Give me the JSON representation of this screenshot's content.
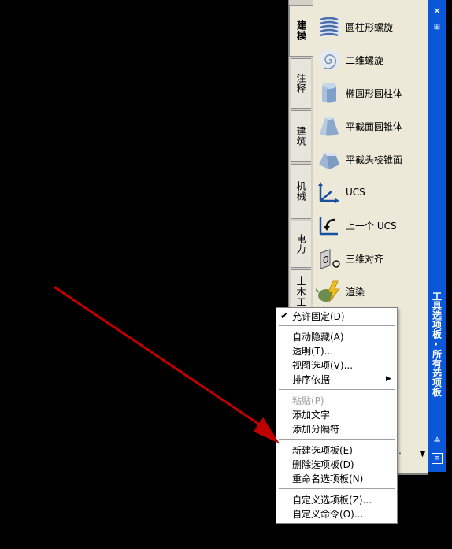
{
  "palette": {
    "tabs": [
      "建模",
      "注释",
      "建筑",
      "机械",
      "电力",
      "土木工程"
    ],
    "tools": [
      {
        "label": "圆柱形螺旋",
        "icon": "helix-icon"
      },
      {
        "label": "二维螺旋",
        "icon": "spiral-icon"
      },
      {
        "label": "椭圆形圆柱体",
        "icon": "elliptical-cylinder-icon"
      },
      {
        "label": "平截面圆锥体",
        "icon": "frustum-cone-icon"
      },
      {
        "label": "平截头棱锥面",
        "icon": "frustum-pyramid-icon"
      },
      {
        "label": "UCS",
        "icon": "ucs-icon"
      },
      {
        "label": "上一个 UCS",
        "icon": "previous-ucs-icon"
      },
      {
        "label": "三维对齐",
        "icon": "3d-align-icon"
      },
      {
        "label": "渲染",
        "icon": "render-teapot-icon"
      }
    ],
    "title": "工具选项板 - 所有选项板",
    "partial_text": "I."
  },
  "context_menu": {
    "items": [
      {
        "label": "允许固定(D)",
        "checked": true
      },
      {
        "label": "自动隐藏(A)"
      },
      {
        "label": "透明(T)..."
      },
      {
        "label": "视图选项(V)..."
      },
      {
        "label": "排序依据",
        "submenu": true
      },
      {
        "label": "粘贴(P)",
        "disabled": true
      },
      {
        "label": "添加文字"
      },
      {
        "label": "添加分隔符"
      },
      {
        "label": "新建选项板(E)"
      },
      {
        "label": "删除选项板(D)"
      },
      {
        "label": "重命名选项板(N)"
      },
      {
        "label": "自定义选项板(Z)..."
      },
      {
        "label": "自定义命令(O)..."
      }
    ]
  },
  "colors": {
    "title_bar": "#0a58d8",
    "arrow": "#c00000",
    "background": "#000000"
  }
}
